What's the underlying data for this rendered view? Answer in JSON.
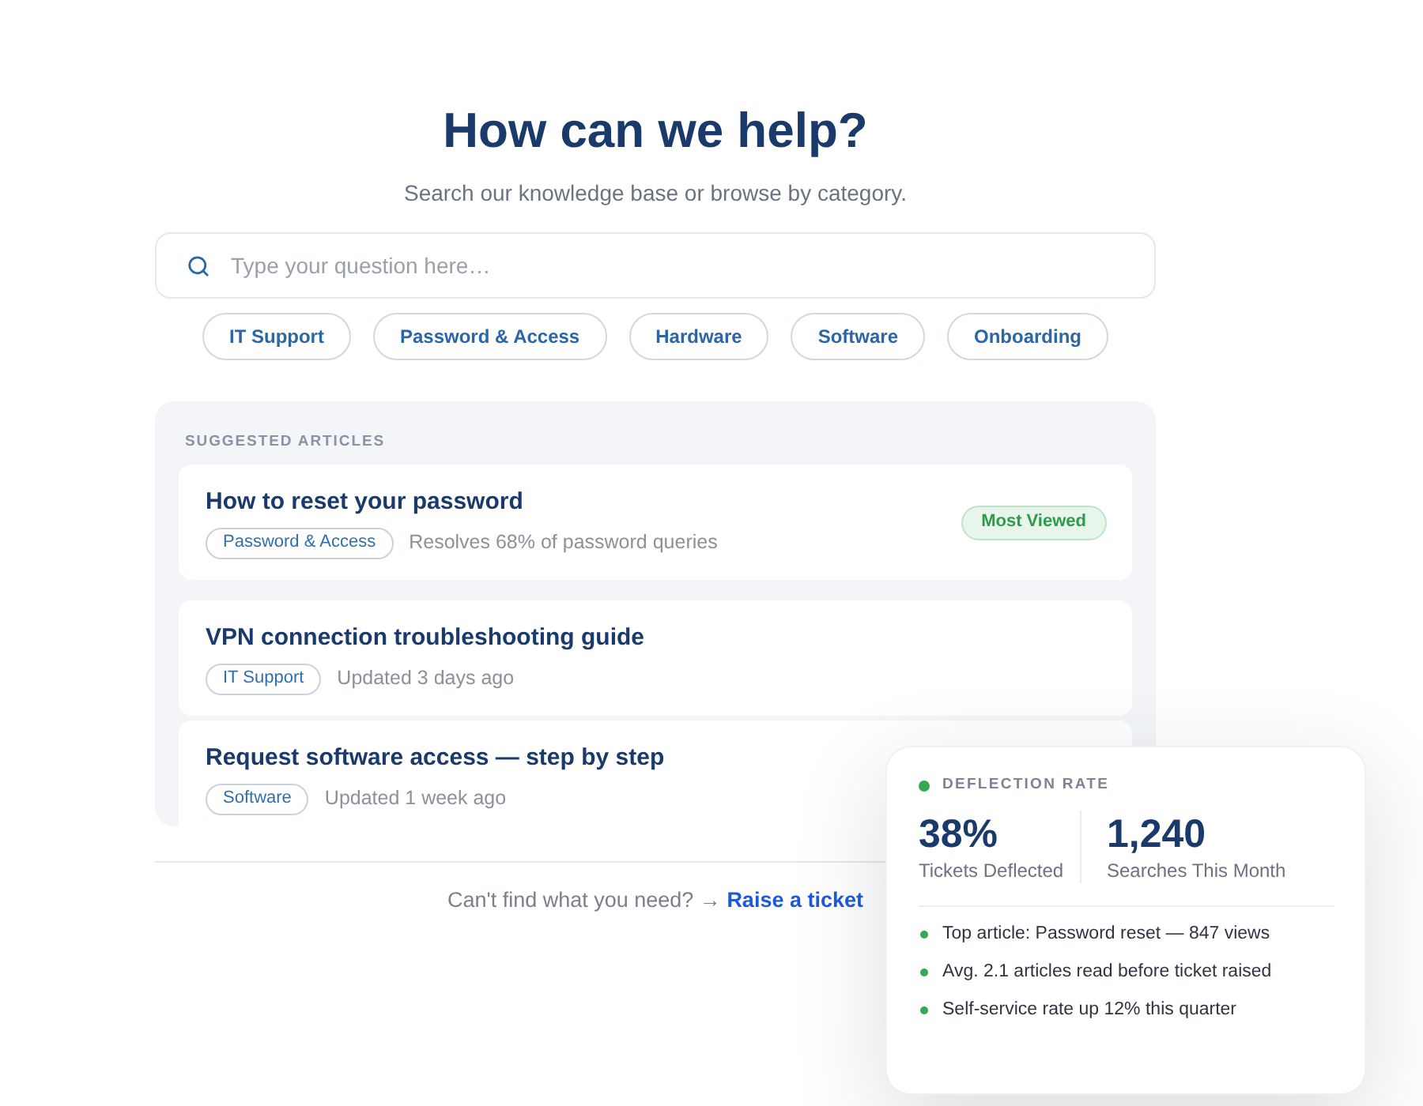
{
  "hero": {
    "title": "How can we help?",
    "subtitle": "Search our knowledge base or browse by category."
  },
  "search": {
    "placeholder": "Type your question here…"
  },
  "categories": [
    "IT Support",
    "Password & Access",
    "Hardware",
    "Software",
    "Onboarding"
  ],
  "suggested": {
    "heading": "SUGGESTED ARTICLES",
    "articles": [
      {
        "title": "How to reset your password",
        "tag": "Password & Access",
        "meta": "Resolves 68% of password queries",
        "badge": "Most Viewed"
      },
      {
        "title": "VPN connection troubleshooting guide",
        "tag": "IT Support",
        "meta": "Updated 3 days ago"
      },
      {
        "title": "Request software access — step by step",
        "tag": "Software",
        "meta": "Updated 1 week ago"
      }
    ]
  },
  "footer": {
    "prompt": "Can't find what you need? →",
    "link": "Raise a ticket"
  },
  "stats_card": {
    "heading": "DEFLECTION RATE",
    "stats": [
      {
        "value": "38%",
        "label": "Tickets Deflected"
      },
      {
        "value": "1,240",
        "label": "Searches This Month"
      }
    ],
    "highlights": [
      "Top article: Password reset — 847 views",
      "Avg. 2.1 articles read before ticket raised",
      "Self-service rate up 12% this quarter"
    ]
  }
}
